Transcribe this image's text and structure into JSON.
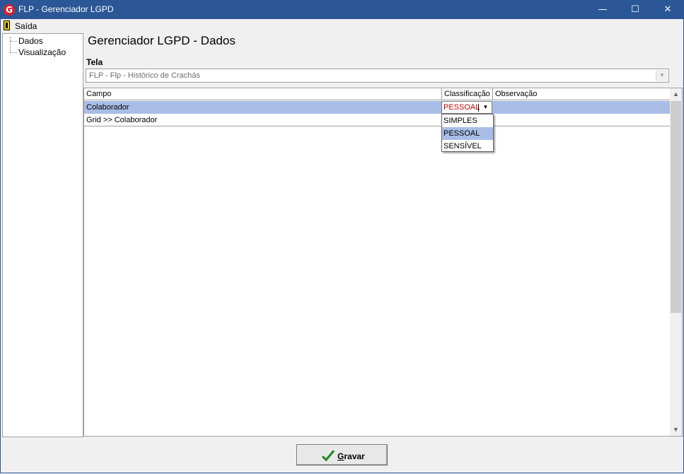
{
  "window": {
    "title": "FLP - Gerenciador LGPD",
    "app_icon_letter": "G",
    "controls": {
      "minimize": "—",
      "maximize": "☐",
      "close": "✕"
    }
  },
  "menu": {
    "exit_label": "Saída",
    "exit_icon": "door-exit-icon"
  },
  "tree": {
    "items": [
      {
        "label": "Dados"
      },
      {
        "label": "Visualização"
      }
    ]
  },
  "page": {
    "title": "Gerenciador LGPD - Dados"
  },
  "tela": {
    "label": "Tela",
    "selected": "FLP - Flp - Histórico de Crachás"
  },
  "grid": {
    "columns": [
      "Campo",
      "Classificação",
      "Observação"
    ],
    "rows": [
      {
        "campo": "Colaborador",
        "classificacao": "PESSOAL",
        "observacao": ""
      },
      {
        "campo": "Grid >> Colaborador",
        "classificacao": "",
        "observacao": ""
      }
    ],
    "editor_value": "PESSOAL",
    "dropdown_options": [
      "SIMPLES",
      "PESSOAL",
      "SENSÍVEL"
    ],
    "dropdown_selected": "PESSOAL"
  },
  "actions": {
    "save_first_letter": "G",
    "save_rest": "ravar",
    "save_icon": "checkmark-icon"
  },
  "colors": {
    "titlebar": "#2b5797",
    "selected_row": "#a8bde6",
    "editor_text": "#c00000",
    "checkmark": "#1a8a1a"
  }
}
